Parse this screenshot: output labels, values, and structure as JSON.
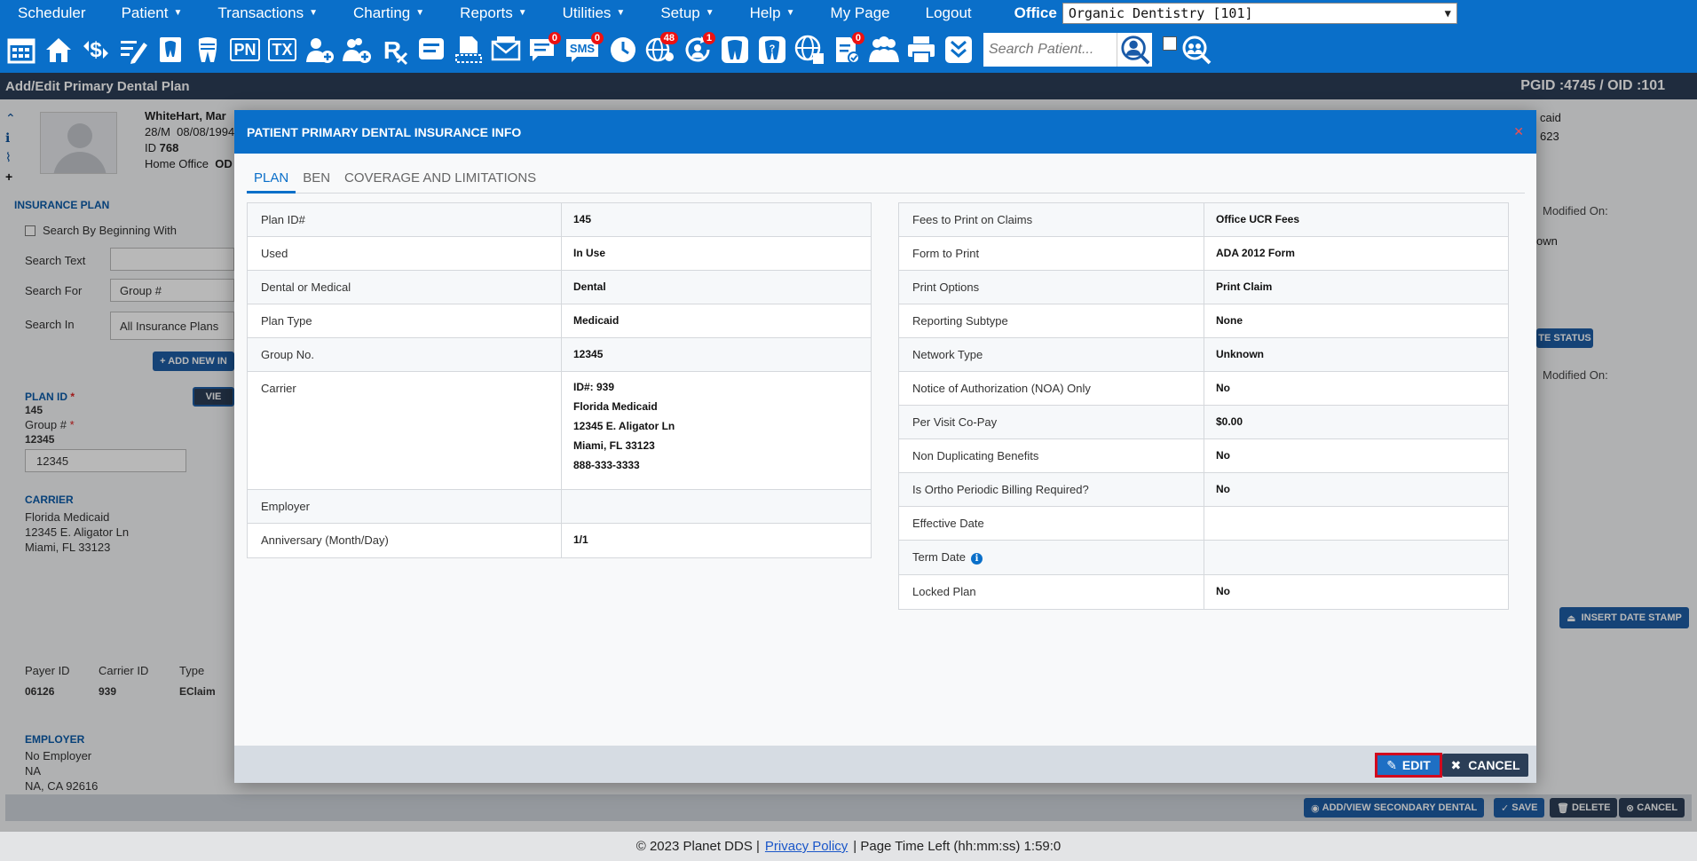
{
  "menu": {
    "items": [
      {
        "label": "Scheduler",
        "caret": false
      },
      {
        "label": "Patient",
        "caret": true
      },
      {
        "label": "Transactions",
        "caret": true
      },
      {
        "label": "Charting",
        "caret": true
      },
      {
        "label": "Reports",
        "caret": true
      },
      {
        "label": "Utilities",
        "caret": true
      },
      {
        "label": "Setup",
        "caret": true
      },
      {
        "label": "Help",
        "caret": true
      },
      {
        "label": "My Page",
        "caret": false
      },
      {
        "label": "Logout",
        "caret": false
      }
    ],
    "office_label": "Office",
    "office_value": "Organic Dentistry [101]"
  },
  "toolbar": {
    "text_icons": {
      "pn": "PN",
      "tx": "TX",
      "sms": "SMS"
    },
    "badges": {
      "messages": "0",
      "sms": "0",
      "web": "48",
      "recall": "1",
      "notes": "0"
    },
    "search_placeholder": "Search Patient..."
  },
  "titlebar": {
    "title": "Add/Edit Primary Dental Plan",
    "ids": "PGID :4745  /  OID :101"
  },
  "background": {
    "patient_name": "WhiteHart, Mar",
    "patient_age": "28/M",
    "patient_dob": "08/08/1994",
    "patient_id_label": "ID",
    "patient_id": "768",
    "home_office_label": "Home Office",
    "home_office": "OD",
    "right_top_1": "caid",
    "right_top_2": "623",
    "insurance_plan_label": "INSURANCE PLAN",
    "search_by_beginning": "Search By Beginning With",
    "search_text_label": "Search Text",
    "search_for_label": "Search For",
    "search_for_value": "Group #",
    "search_in_label": "Search In",
    "search_in_value": "All Insurance Plans",
    "add_new_label": "+ ADD NEW IN",
    "plan_id_label": "PLAN ID",
    "plan_id_value": "145",
    "group_label": "Group #",
    "group_value": "12345",
    "group_field_value": "12345",
    "view_label": "VIE",
    "carrier_label": "CARRIER",
    "carrier_lines": [
      "Florida Medicaid",
      "12345 E. Aligator Ln",
      "Miami, FL 33123"
    ],
    "payer_id_label": "Payer ID",
    "carrier_id_label": "Carrier ID",
    "type_label": "Type",
    "payer_id": "06126",
    "carrier_id": "939",
    "type": "EClaim",
    "employer_label": "EMPLOYER",
    "employer_lines": [
      "No Employer",
      "NA",
      "NA, CA 92616"
    ],
    "modified_on_1": "Modified On:",
    "unknown_partial": "own",
    "status_btn": "TE STATUS",
    "modified_on_2": "Modified On:",
    "insert_date_stamp": "INSERT DATE STAMP",
    "btn_secondary": "ADD/VIEW SECONDARY DENTAL",
    "btn_save": "SAVE",
    "btn_delete": "DELETE",
    "btn_cancel": "CANCEL"
  },
  "modal": {
    "title": "PATIENT PRIMARY DENTAL INSURANCE INFO",
    "tabs": [
      "PLAN",
      "BEN",
      "COVERAGE AND LIMITATIONS"
    ],
    "left": [
      {
        "key": "Plan ID#",
        "value": "145"
      },
      {
        "key": "Used",
        "value": "In Use"
      },
      {
        "key": "Dental or Medical",
        "value": "Dental"
      },
      {
        "key": "Plan Type",
        "value": "Medicaid"
      },
      {
        "key": "Group No.",
        "value": "12345"
      },
      {
        "key": "Employer",
        "value": ""
      },
      {
        "key": "Anniversary (Month/Day)",
        "value": "1/1"
      }
    ],
    "carrier": {
      "key": "Carrier",
      "lines": [
        "ID#: 939",
        "Florida Medicaid",
        "12345 E. Aligator Ln",
        "Miami, FL 33123",
        "888-333-3333"
      ]
    },
    "right": [
      {
        "key": "Fees to Print on Claims",
        "value": "Office UCR Fees"
      },
      {
        "key": "Form to Print",
        "value": "ADA 2012 Form"
      },
      {
        "key": "Print Options",
        "value": "Print Claim"
      },
      {
        "key": "Reporting Subtype",
        "value": "None"
      },
      {
        "key": "Network Type",
        "value": "Unknown"
      },
      {
        "key": "Notice of Authorization (NOA) Only",
        "value": "No"
      },
      {
        "key": "Per Visit Co-Pay",
        "value": "$0.00"
      },
      {
        "key": "Non Duplicating Benefits",
        "value": "No"
      },
      {
        "key": "Is Ortho Periodic Billing Required?",
        "value": "No"
      },
      {
        "key": "Effective Date",
        "value": ""
      },
      {
        "key": "Term Date",
        "value": ""
      },
      {
        "key": "Locked Plan",
        "value": "No"
      }
    ],
    "edit_label": "EDIT",
    "cancel_label": "CANCEL"
  },
  "footer": {
    "copyright": "© 2023 Planet DDS |",
    "privacy": "Privacy Policy",
    "time_left": "|  Page Time Left (hh:mm:ss) 1:59:0"
  }
}
